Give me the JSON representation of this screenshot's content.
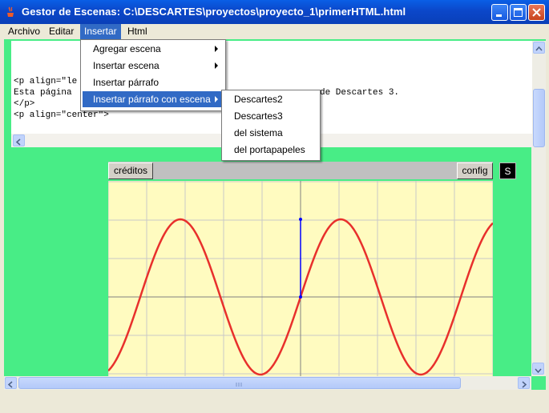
{
  "window": {
    "title": "Gestor de Escenas: C:\\DESCARTES\\proyectos\\proyecto_1\\primerHTML.html"
  },
  "menubar": {
    "items": [
      "Archivo",
      "Editar",
      "Insertar",
      "Html"
    ],
    "active": "Insertar"
  },
  "insert_menu": {
    "items": [
      {
        "label": "Agregar escena",
        "submenu": true
      },
      {
        "label": "Insertar escena",
        "submenu": true
      },
      {
        "label": "Insertar párrafo",
        "submenu": false
      },
      {
        "label": "Insertar párrafo con escena",
        "submenu": true,
        "highlighted": true
      }
    ]
  },
  "scene_submenu": {
    "items": [
      "Descartes2",
      "Descartes3",
      "del sistema",
      "del portapapeles"
    ]
  },
  "editor": {
    "lines": [
      "<p align=\"le",
      "Esta página",
      "</p>",
      "<p align=\"center\">"
    ],
    "line2_tail": "de Descartes 3."
  },
  "scene": {
    "creditos_label": "créditos",
    "config_label": "config",
    "s_label": "S"
  },
  "colors": {
    "frame": "#48ed86",
    "plot_bg": "#fffbc0",
    "curve": "#e8302c",
    "segment": "#0000ff",
    "accent": "#316ac5"
  },
  "icons": {
    "app": "java-cup-icon",
    "minimize": "minimize-icon",
    "maximize": "maximize-icon",
    "close": "close-icon"
  }
}
